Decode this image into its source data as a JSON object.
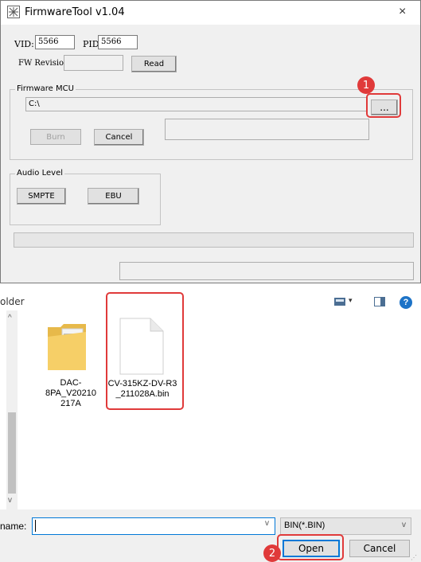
{
  "app": {
    "title": "FirmwareTool v1.04",
    "close_symbol": "×"
  },
  "device": {
    "vid_label": "VID:",
    "vid_value": "5566",
    "pid_label": "PID:",
    "pid_value": "5566",
    "fw_revision_label": "FW Revision:",
    "fw_revision_value": "",
    "read_button": "Read"
  },
  "firmware_mcu": {
    "legend": "Firmware MCU",
    "path_value": "C:\\",
    "browse_button": "...",
    "burn_button": "Burn",
    "cancel_button": "Cancel",
    "status_value": ""
  },
  "audio_level": {
    "legend": "Audio Level",
    "smpte_button": "SMPTE",
    "ebu_button": "EBU"
  },
  "markers": {
    "step1": "1",
    "step2": "2"
  },
  "dialog": {
    "breadcrumb_partial": "older",
    "files": [
      {
        "name": "DAC-8PA_V20210\n217A",
        "icon": "folder-icon"
      },
      {
        "name": "CV-315KZ-DV-R3\n_211028A.bin",
        "icon": "file-icon"
      }
    ],
    "file_name_label": "name:",
    "file_name_value": "",
    "filter_value": "BIN(*.BIN)",
    "open_button": "Open",
    "cancel_button": "Cancel"
  },
  "colors": {
    "highlight": "#e03a3a",
    "accent": "#0078d7"
  }
}
